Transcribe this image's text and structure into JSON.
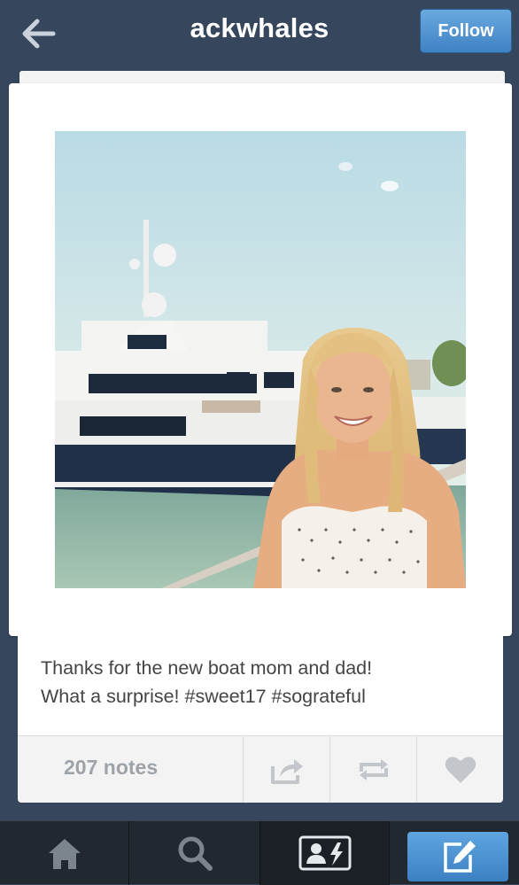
{
  "header": {
    "title": "ackwhales",
    "follow_label": "Follow",
    "back_icon": "arrow-left-icon"
  },
  "post": {
    "caption_line1": "Thanks for the new boat mom and dad!",
    "caption_line2": "What a surprise! #sweet17 #sograteful",
    "notes_label": "207 notes",
    "actions": [
      "share-icon",
      "reblog-icon",
      "heart-icon"
    ]
  },
  "tabbar": {
    "tabs": [
      "home-icon",
      "search-icon",
      "account-icon",
      "compose-icon"
    ]
  },
  "colors": {
    "header_bg": "#36465d",
    "follow_button": "#4a8fd0",
    "compose_button": "#529bd8",
    "tabbar_bg": "#222830"
  }
}
